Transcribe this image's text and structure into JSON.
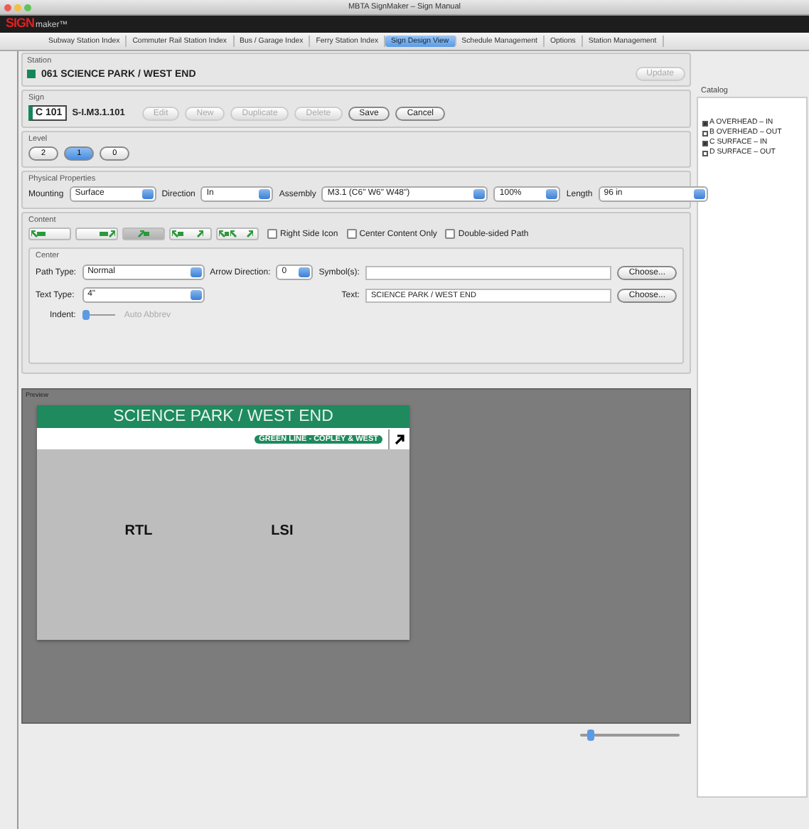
{
  "window": {
    "title": "MBTA SignMaker – Sign Manual"
  },
  "logo": {
    "brand": "SIGN",
    "suffix": "maker™"
  },
  "tabs": [
    {
      "label": "Subway Station Index",
      "selected": false
    },
    {
      "label": "Commuter Rail Station Index",
      "selected": false
    },
    {
      "label": "Bus / Garage Index",
      "selected": false
    },
    {
      "label": "Ferry Station Index",
      "selected": false
    },
    {
      "label": "Sign Design View",
      "selected": true
    },
    {
      "label": "Schedule Management",
      "selected": false
    },
    {
      "label": "Options",
      "selected": false
    },
    {
      "label": "Station Management",
      "selected": false
    }
  ],
  "station": {
    "label": "Station",
    "name": "061 SCIENCE PARK / WEST END",
    "color": "#16865a",
    "button": "Update"
  },
  "sign": {
    "label": "Sign",
    "code": "C 101",
    "id": "S-I.M3.1.101",
    "buttons": [
      {
        "label": "Edit",
        "disabled": true
      },
      {
        "label": "New",
        "disabled": true
      },
      {
        "label": "Duplicate",
        "disabled": true
      },
      {
        "label": "Delete",
        "disabled": true
      },
      {
        "label": "Save",
        "disabled": false
      },
      {
        "label": "Cancel",
        "disabled": false
      }
    ]
  },
  "level": {
    "label": "Level",
    "options": [
      {
        "label": "2",
        "selected": false
      },
      {
        "label": "1",
        "selected": true
      },
      {
        "label": "0",
        "selected": false
      }
    ]
  },
  "physical": {
    "label": "Physical Properties",
    "fields": [
      {
        "label": "Mounting",
        "value": "Surface"
      },
      {
        "label": "Direction",
        "value": "In"
      },
      {
        "label": "Assembly",
        "value": "M3.1 (C6\" W6\" W48\")"
      },
      {
        "value": "100%"
      },
      {
        "label": "Length",
        "value": "96 in"
      }
    ]
  },
  "content": {
    "label": "Content",
    "layouts": [
      {
        "kind": "left",
        "selected": false
      },
      {
        "kind": "right",
        "selected": false
      },
      {
        "kind": "center",
        "selected": true
      },
      {
        "kind": "split",
        "selected": false
      },
      {
        "kind": "triple",
        "selected": false
      }
    ],
    "options": [
      {
        "label": "Right Side Icon",
        "checked": false
      },
      {
        "label": "Center Content Only",
        "checked": false
      },
      {
        "label": "Double-sided Path",
        "checked": false
      }
    ]
  },
  "center": {
    "label": "Center",
    "path_type_label": "Path Type:",
    "path_type": "Normal",
    "arrow_label": "Arrow Direction:",
    "arrow": "0",
    "symbols_label": "Symbol(s):",
    "choose_1": "Choose...",
    "text_type_label": "Text Type:",
    "text_type": "4\"",
    "text_label": "Text:",
    "text": "SCIENCE PARK / WEST END",
    "choose_2": "Choose...",
    "indent_label": "Indent:",
    "indent": {
      "level": 0.05
    },
    "auto_abbrev": {
      "label": "Auto Abbrev",
      "disabled": true
    }
  },
  "catalog": {
    "title": "Catalog",
    "items": [
      {
        "label": "A OVERHEAD – IN",
        "checked": true
      },
      {
        "label": "B OVERHEAD – OUT",
        "checked": false
      },
      {
        "label": "C SURFACE – IN",
        "checked": true
      },
      {
        "label": "D SURFACE – OUT",
        "checked": false
      }
    ]
  },
  "preview": {
    "label": "Preview",
    "header": "SCIENCE PARK / WEST END",
    "line_tag": "GREEN LINE - COPLEY & WEST",
    "labels": [
      "RTL",
      "LSI"
    ],
    "zoom": {
      "level": 0.1
    }
  }
}
